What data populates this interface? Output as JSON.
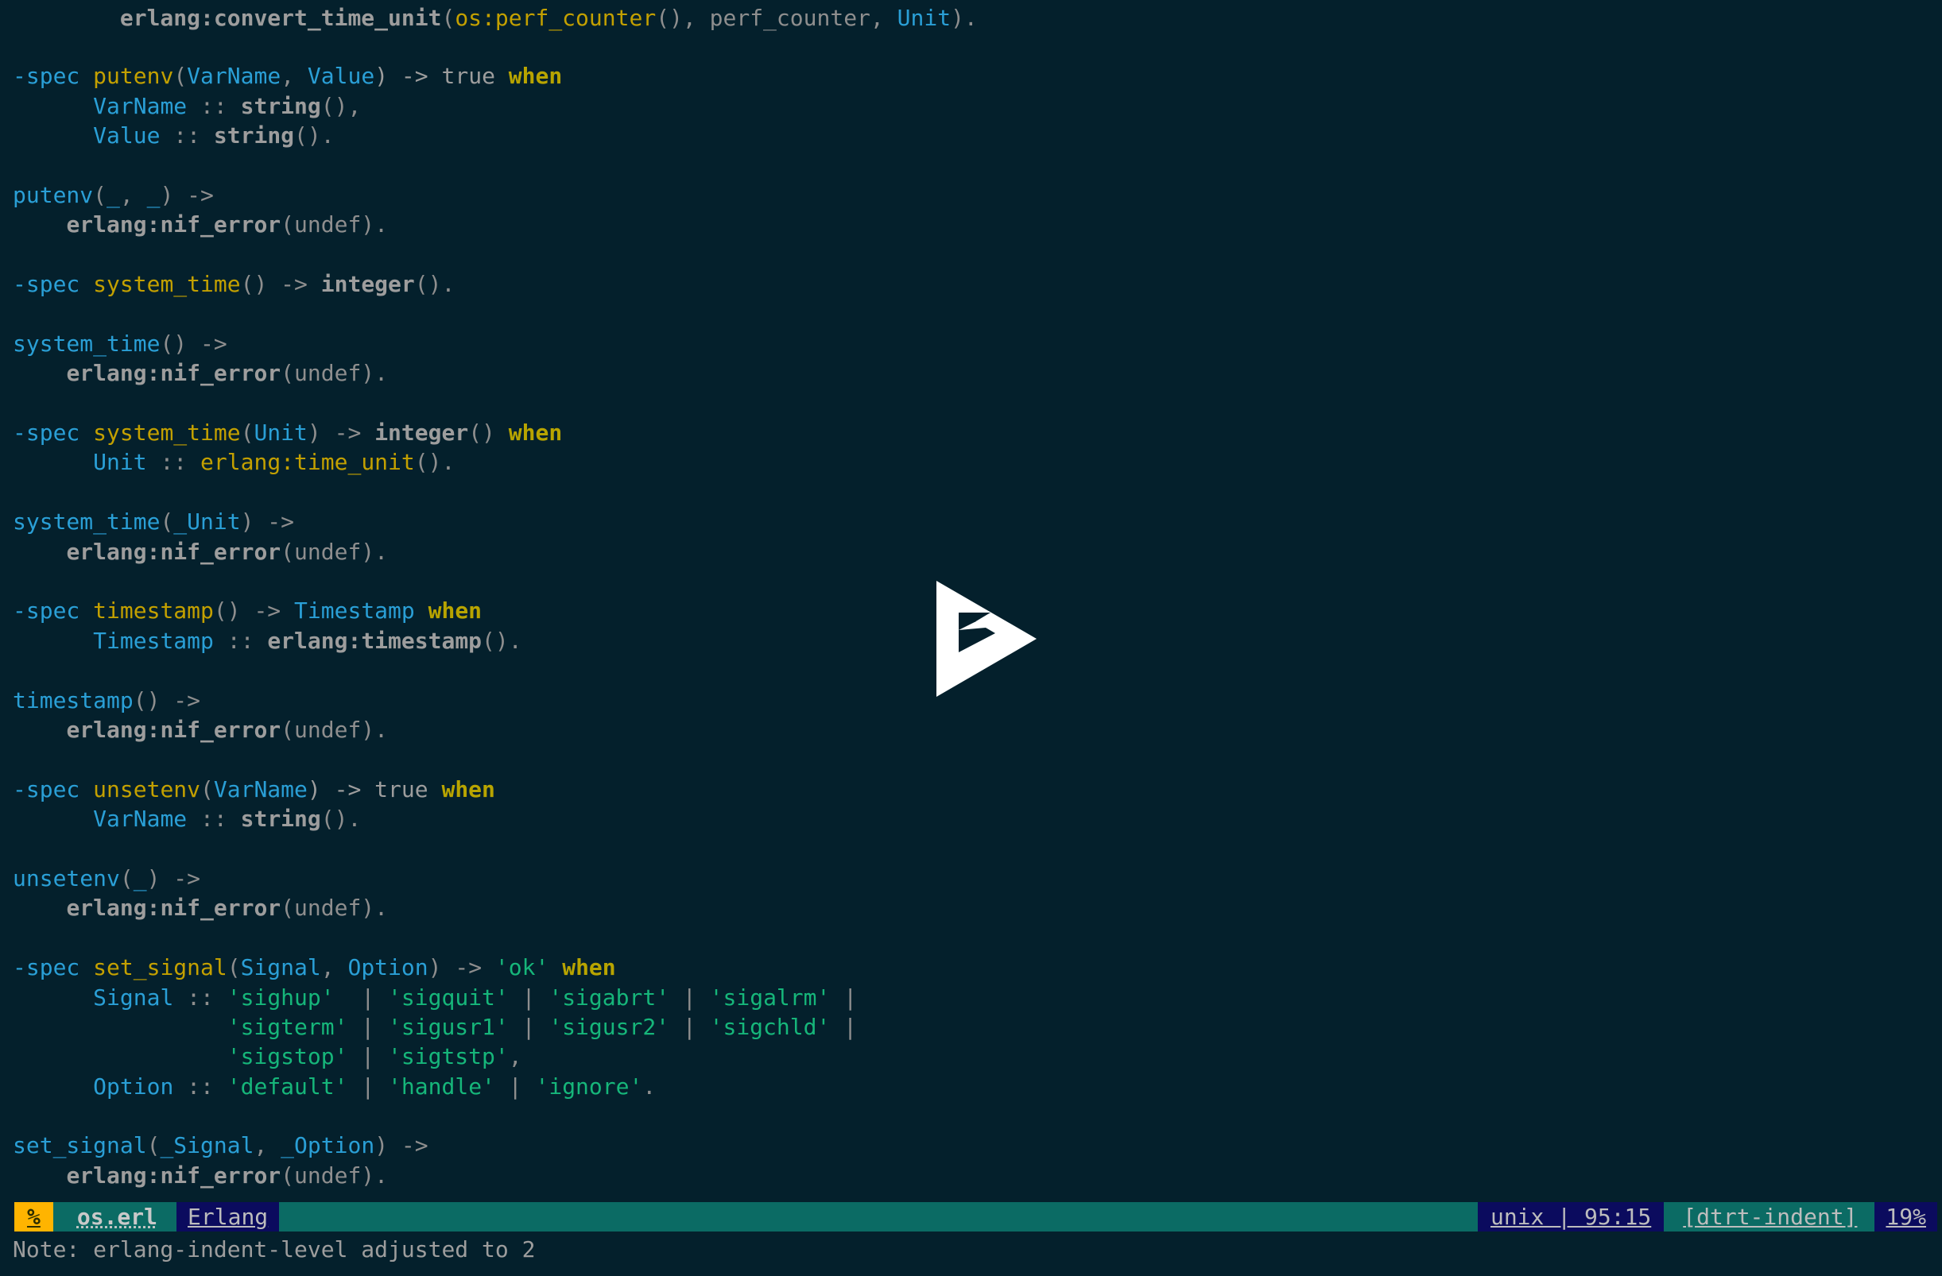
{
  "editor": {
    "app": "emacs",
    "background": "#04202c",
    "colors": {
      "background": "#04202c",
      "default_text": "#9d9d9d",
      "blue": "#2a9fd6",
      "gold": "#c3a000",
      "olive": "#b8a400",
      "green": "#16b67a",
      "modeline_teal": "#0b6b64",
      "modeline_navy": "#0b0b5e",
      "badge_orange": "#ffb400",
      "logo_white": "#ffffff"
    }
  },
  "code": {
    "language": "Erlang",
    "lines": [
      [
        {
          "t": "        ",
          "c": "t-punct"
        },
        {
          "t": "erlang:",
          "c": "t-builtin"
        },
        {
          "t": "convert_time_unit",
          "c": "t-builtin"
        },
        {
          "t": "(",
          "c": "t-punct"
        },
        {
          "t": "os:perf_counter",
          "c": "t-type"
        },
        {
          "t": "(), perf_counter, ",
          "c": "t-punct"
        },
        {
          "t": "Unit",
          "c": "t-var"
        },
        {
          "t": ").",
          "c": "t-punct"
        }
      ],
      [],
      [
        {
          "t": "-spec",
          "c": "t-keyword"
        },
        {
          "t": " ",
          "c": "t-punct"
        },
        {
          "t": "putenv",
          "c": "t-type"
        },
        {
          "t": "(",
          "c": "t-punct"
        },
        {
          "t": "VarName",
          "c": "t-var"
        },
        {
          "t": ", ",
          "c": "t-punct"
        },
        {
          "t": "Value",
          "c": "t-var"
        },
        {
          "t": ") -> true ",
          "c": "t-default"
        },
        {
          "t": "when",
          "c": "t-when"
        }
      ],
      [
        {
          "t": "      ",
          "c": "t-punct"
        },
        {
          "t": "VarName",
          "c": "t-var"
        },
        {
          "t": " :: ",
          "c": "t-punct"
        },
        {
          "t": "string",
          "c": "t-builtin"
        },
        {
          "t": "(),",
          "c": "t-punct"
        }
      ],
      [
        {
          "t": "      ",
          "c": "t-punct"
        },
        {
          "t": "Value",
          "c": "t-var"
        },
        {
          "t": " :: ",
          "c": "t-punct"
        },
        {
          "t": "string",
          "c": "t-builtin"
        },
        {
          "t": "().",
          "c": "t-punct"
        }
      ],
      [],
      [
        {
          "t": "putenv",
          "c": "t-func"
        },
        {
          "t": "(",
          "c": "t-punct"
        },
        {
          "t": "_",
          "c": "t-var"
        },
        {
          "t": ", ",
          "c": "t-punct"
        },
        {
          "t": "_",
          "c": "t-var"
        },
        {
          "t": ") ->",
          "c": "t-punct"
        }
      ],
      [
        {
          "t": "    ",
          "c": "t-punct"
        },
        {
          "t": "erlang:nif_error",
          "c": "t-builtin"
        },
        {
          "t": "(undef).",
          "c": "t-punct"
        }
      ],
      [],
      [
        {
          "t": "-spec",
          "c": "t-keyword"
        },
        {
          "t": " ",
          "c": "t-punct"
        },
        {
          "t": "system_time",
          "c": "t-type"
        },
        {
          "t": "() -> ",
          "c": "t-punct"
        },
        {
          "t": "integer",
          "c": "t-builtin"
        },
        {
          "t": "().",
          "c": "t-punct"
        }
      ],
      [],
      [
        {
          "t": "system_time",
          "c": "t-func"
        },
        {
          "t": "() ->",
          "c": "t-punct"
        }
      ],
      [
        {
          "t": "    ",
          "c": "t-punct"
        },
        {
          "t": "erlang:nif_error",
          "c": "t-builtin"
        },
        {
          "t": "(undef).",
          "c": "t-punct"
        }
      ],
      [],
      [
        {
          "t": "-spec",
          "c": "t-keyword"
        },
        {
          "t": " ",
          "c": "t-punct"
        },
        {
          "t": "system_time",
          "c": "t-type"
        },
        {
          "t": "(",
          "c": "t-punct"
        },
        {
          "t": "Unit",
          "c": "t-var"
        },
        {
          "t": ") -> ",
          "c": "t-punct"
        },
        {
          "t": "integer",
          "c": "t-builtin"
        },
        {
          "t": "() ",
          "c": "t-punct"
        },
        {
          "t": "when",
          "c": "t-when"
        }
      ],
      [
        {
          "t": "      ",
          "c": "t-punct"
        },
        {
          "t": "Unit",
          "c": "t-var"
        },
        {
          "t": " :: ",
          "c": "t-punct"
        },
        {
          "t": "erlang:time_unit",
          "c": "t-type"
        },
        {
          "t": "().",
          "c": "t-punct"
        }
      ],
      [],
      [
        {
          "t": "system_time",
          "c": "t-func"
        },
        {
          "t": "(",
          "c": "t-punct"
        },
        {
          "t": "_Unit",
          "c": "t-var"
        },
        {
          "t": ") ->",
          "c": "t-punct"
        }
      ],
      [
        {
          "t": "    ",
          "c": "t-punct"
        },
        {
          "t": "erlang:nif_error",
          "c": "t-builtin"
        },
        {
          "t": "(undef).",
          "c": "t-punct"
        }
      ],
      [],
      [
        {
          "t": "-spec",
          "c": "t-keyword"
        },
        {
          "t": " ",
          "c": "t-punct"
        },
        {
          "t": "timestamp",
          "c": "t-type"
        },
        {
          "t": "() -> ",
          "c": "t-punct"
        },
        {
          "t": "Timestamp",
          "c": "t-var"
        },
        {
          "t": " ",
          "c": "t-punct"
        },
        {
          "t": "when",
          "c": "t-when"
        }
      ],
      [
        {
          "t": "      ",
          "c": "t-punct"
        },
        {
          "t": "Timestamp",
          "c": "t-var"
        },
        {
          "t": " :: ",
          "c": "t-punct"
        },
        {
          "t": "erlang:timestamp",
          "c": "t-builtin"
        },
        {
          "t": "().",
          "c": "t-punct"
        }
      ],
      [],
      [
        {
          "t": "timestamp",
          "c": "t-func"
        },
        {
          "t": "() ->",
          "c": "t-punct"
        }
      ],
      [
        {
          "t": "    ",
          "c": "t-punct"
        },
        {
          "t": "erlang:nif_error",
          "c": "t-builtin"
        },
        {
          "t": "(undef).",
          "c": "t-punct"
        }
      ],
      [],
      [
        {
          "t": "-spec",
          "c": "t-keyword"
        },
        {
          "t": " ",
          "c": "t-punct"
        },
        {
          "t": "unsetenv",
          "c": "t-type"
        },
        {
          "t": "(",
          "c": "t-punct"
        },
        {
          "t": "VarName",
          "c": "t-var"
        },
        {
          "t": ") -> true ",
          "c": "t-default"
        },
        {
          "t": "when",
          "c": "t-when"
        }
      ],
      [
        {
          "t": "      ",
          "c": "t-punct"
        },
        {
          "t": "VarName",
          "c": "t-var"
        },
        {
          "t": " :: ",
          "c": "t-punct"
        },
        {
          "t": "string",
          "c": "t-builtin"
        },
        {
          "t": "().",
          "c": "t-punct"
        }
      ],
      [],
      [
        {
          "t": "unsetenv",
          "c": "t-func"
        },
        {
          "t": "(",
          "c": "t-punct"
        },
        {
          "t": "_",
          "c": "t-var"
        },
        {
          "t": ") ->",
          "c": "t-punct"
        }
      ],
      [
        {
          "t": "    ",
          "c": "t-punct"
        },
        {
          "t": "erlang:nif_error",
          "c": "t-builtin"
        },
        {
          "t": "(undef).",
          "c": "t-punct"
        }
      ],
      [],
      [
        {
          "t": "-spec",
          "c": "t-keyword"
        },
        {
          "t": " ",
          "c": "t-punct"
        },
        {
          "t": "set_signal",
          "c": "t-type"
        },
        {
          "t": "(",
          "c": "t-punct"
        },
        {
          "t": "Signal",
          "c": "t-var"
        },
        {
          "t": ", ",
          "c": "t-punct"
        },
        {
          "t": "Option",
          "c": "t-var"
        },
        {
          "t": ") -> ",
          "c": "t-punct"
        },
        {
          "t": "'ok'",
          "c": "t-string"
        },
        {
          "t": " ",
          "c": "t-punct"
        },
        {
          "t": "when",
          "c": "t-when"
        }
      ],
      [
        {
          "t": "      ",
          "c": "t-punct"
        },
        {
          "t": "Signal",
          "c": "t-var"
        },
        {
          "t": " :: ",
          "c": "t-punct"
        },
        {
          "t": "'sighup'",
          "c": "t-string"
        },
        {
          "t": "  | ",
          "c": "t-punct"
        },
        {
          "t": "'sigquit'",
          "c": "t-string"
        },
        {
          "t": " | ",
          "c": "t-punct"
        },
        {
          "t": "'sigabrt'",
          "c": "t-string"
        },
        {
          "t": " | ",
          "c": "t-punct"
        },
        {
          "t": "'sigalrm'",
          "c": "t-string"
        },
        {
          "t": " |",
          "c": "t-punct"
        }
      ],
      [
        {
          "t": "                ",
          "c": "t-punct"
        },
        {
          "t": "'sigterm'",
          "c": "t-string"
        },
        {
          "t": " | ",
          "c": "t-punct"
        },
        {
          "t": "'sigusr1'",
          "c": "t-string"
        },
        {
          "t": " | ",
          "c": "t-punct"
        },
        {
          "t": "'sigusr2'",
          "c": "t-string"
        },
        {
          "t": " | ",
          "c": "t-punct"
        },
        {
          "t": "'sigchld'",
          "c": "t-string"
        },
        {
          "t": " |",
          "c": "t-punct"
        }
      ],
      [
        {
          "t": "                ",
          "c": "t-punct"
        },
        {
          "t": "'sigstop'",
          "c": "t-string"
        },
        {
          "t": " | ",
          "c": "t-punct"
        },
        {
          "t": "'sigtstp'",
          "c": "t-string"
        },
        {
          "t": ",",
          "c": "t-punct"
        }
      ],
      [
        {
          "t": "      ",
          "c": "t-punct"
        },
        {
          "t": "Option",
          "c": "t-var"
        },
        {
          "t": " :: ",
          "c": "t-punct"
        },
        {
          "t": "'default'",
          "c": "t-string"
        },
        {
          "t": " | ",
          "c": "t-punct"
        },
        {
          "t": "'handle'",
          "c": "t-string"
        },
        {
          "t": " | ",
          "c": "t-punct"
        },
        {
          "t": "'ignore'",
          "c": "t-string"
        },
        {
          "t": ".",
          "c": "t-punct"
        }
      ],
      [],
      [
        {
          "t": "set_signal",
          "c": "t-func"
        },
        {
          "t": "(",
          "c": "t-punct"
        },
        {
          "t": "_Signal",
          "c": "t-var"
        },
        {
          "t": ", ",
          "c": "t-punct"
        },
        {
          "t": "_Option",
          "c": "t-var"
        },
        {
          "t": ") ->",
          "c": "t-punct"
        }
      ],
      [
        {
          "t": "    ",
          "c": "t-punct"
        },
        {
          "t": "erlang:nif_error",
          "c": "t-builtin"
        },
        {
          "t": "(undef).",
          "c": "t-punct"
        }
      ]
    ]
  },
  "overlay": {
    "play_button_label": "asciinema-play-logo"
  },
  "modeline": {
    "modified_indicator": "%",
    "buffer_name": "os.erl",
    "major_mode": "Erlang",
    "coding_system": "unix | 95:15",
    "minor_modes": "[dtrt-indent]",
    "scroll_percent": "19%"
  },
  "minibuffer": {
    "message": "Note: erlang-indent-level adjusted to 2"
  }
}
